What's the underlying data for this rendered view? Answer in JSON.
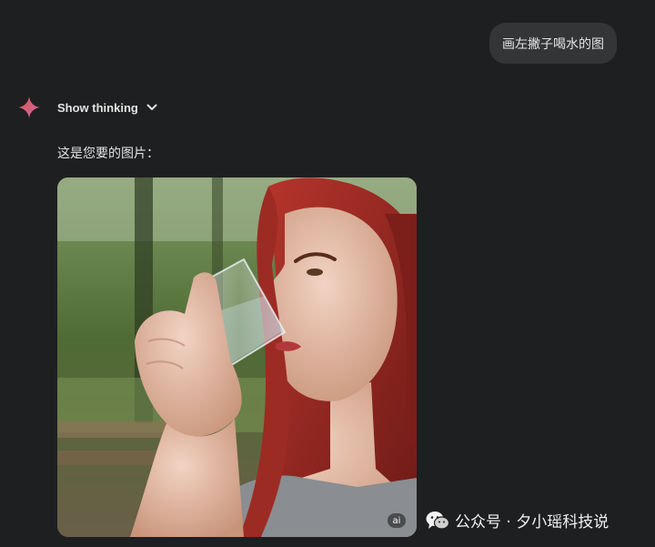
{
  "user_message": "画左撇子喝水的图",
  "model": {
    "show_thinking_label": "Show thinking",
    "reply_text": "这是您要的图片：",
    "image_badge": "ai",
    "image_subject": "red-haired woman drinking water from a glass held in her left hand, park background"
  },
  "watermark": {
    "text": "公众号 · 夕小瑶科技说",
    "icon": "wechat-icon"
  },
  "colors": {
    "background": "#1e1f20",
    "bubble": "#333537",
    "sparkle_gradient": [
      "#e0574f",
      "#c768a6"
    ]
  }
}
